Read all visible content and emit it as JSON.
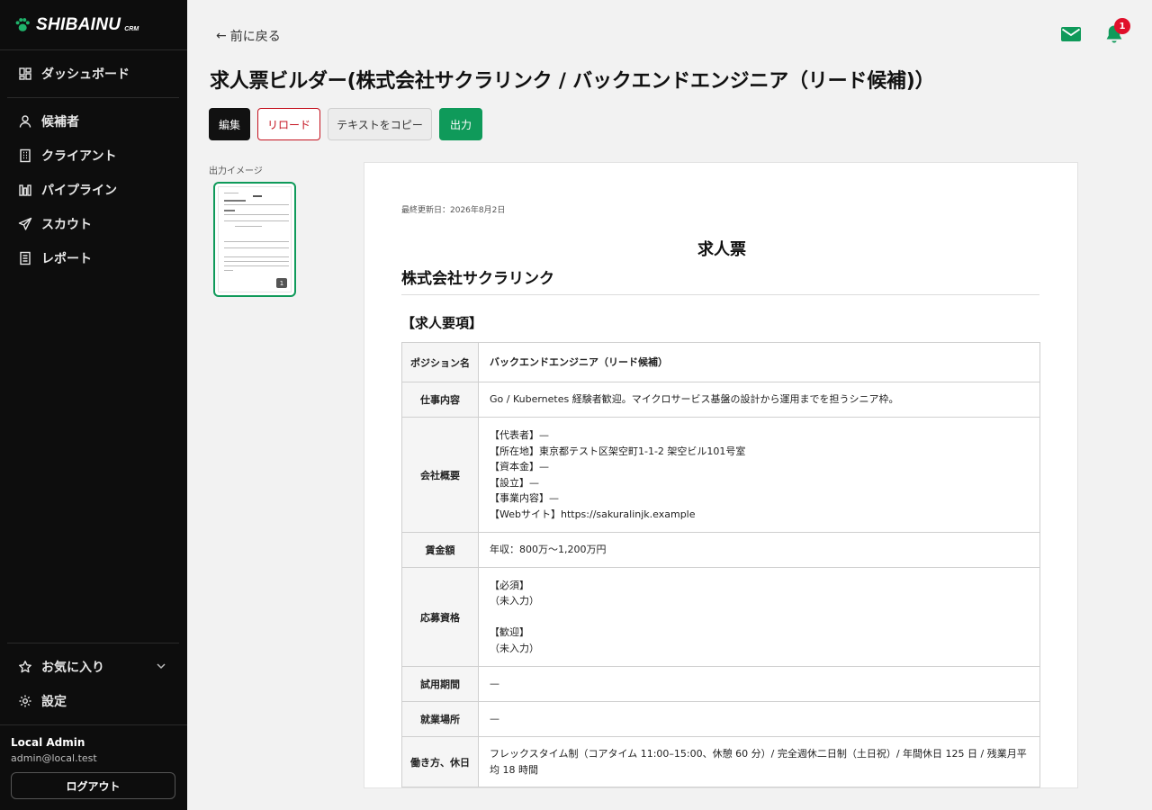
{
  "brand": {
    "name": "SHIBAINU",
    "sub": "CRM"
  },
  "sidebar": {
    "items": [
      {
        "label": "ダッシュボード",
        "icon": "dashboard-icon"
      },
      {
        "label": "候補者",
        "icon": "person-icon"
      },
      {
        "label": "クライアント",
        "icon": "building-icon"
      },
      {
        "label": "パイプライン",
        "icon": "pipeline-icon"
      },
      {
        "label": "スカウト",
        "icon": "send-icon"
      },
      {
        "label": "レポート",
        "icon": "report-icon"
      }
    ],
    "favorites_label": "お気に入り",
    "settings_label": "設定",
    "user": {
      "name": "Local Admin",
      "email": "admin@local.test"
    },
    "logout_label": "ログアウト"
  },
  "header": {
    "back_label": "前に戻る",
    "notification_count": "1",
    "title": "求人票ビルダー(株式会社サクラリンク / バックエンドエンジニア（リード候補)）"
  },
  "toolbar": {
    "edit_label": "編集",
    "reload_label": "リロード",
    "copy_label": "テキストをコピー",
    "export_label": "出力"
  },
  "preview": {
    "label": "出力イメージ",
    "page_number": "1"
  },
  "document": {
    "updated": "最終更新日：2026年8月2日",
    "heading": "求人票",
    "company": "株式会社サクラリンク",
    "section": "【求人要項】",
    "rows": [
      {
        "label": "ポジション名",
        "value": "バックエンドエンジニア（リード候補）"
      },
      {
        "label": "仕事内容",
        "value": "Go / Kubernetes 経験者歓迎。マイクロサービス基盤の設計から運用までを担うシニア枠。"
      },
      {
        "label": "会社概要",
        "value": "【代表者】—\n【所在地】東京都テスト区架空町1-1-2 架空ビル101号室\n【資本金】—\n【設立】—\n【事業内容】—\n【Webサイト】https://sakuralinjk.example"
      },
      {
        "label": "賃金額",
        "value": "年収：800万〜1,200万円"
      },
      {
        "label": "応募資格",
        "value": "【必須】\n（未入力）\n\n【歓迎】\n（未入力）"
      },
      {
        "label": "試用期間",
        "value": "—"
      },
      {
        "label": "就業場所",
        "value": "—"
      },
      {
        "label": "働き方、休日",
        "value": "フレックスタイム制（コアタイム 11:00–15:00、休憩 60 分）/ 完全週休二日制（土日祝）/ 年間休日 125 日 / 残業月平均 18 時間"
      }
    ]
  },
  "colors": {
    "sidebar_bg": "#0d0d0d",
    "accent_green": "#0f9a5a",
    "danger_red": "#c4121f",
    "badge_red": "#e0102b"
  }
}
